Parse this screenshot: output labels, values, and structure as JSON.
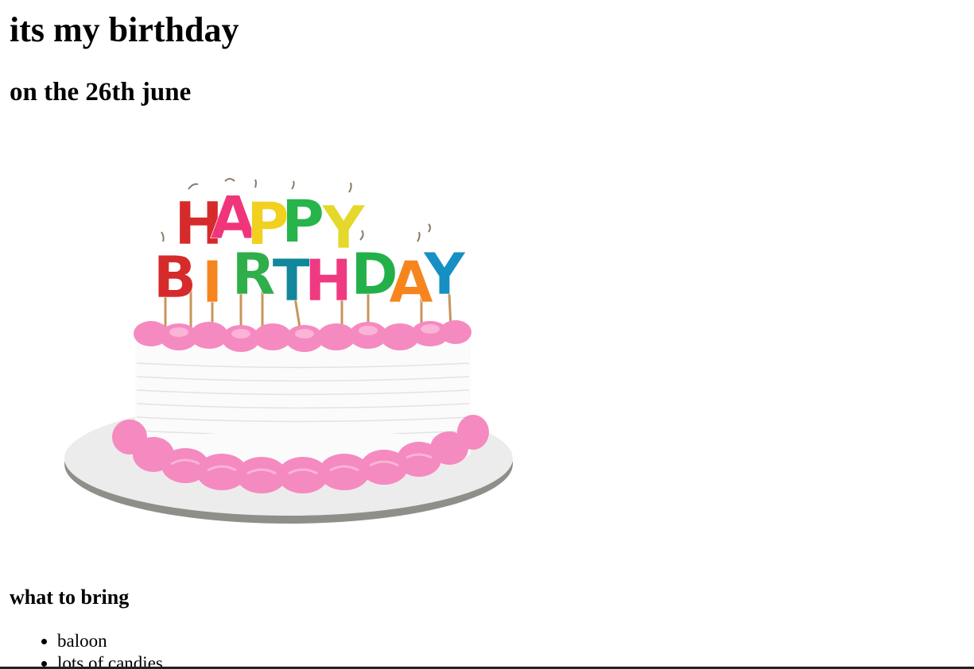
{
  "page": {
    "title": "its my birthday",
    "subtitle": "on the 26th june"
  },
  "cake_image": {
    "icon": "birthday-cake-image",
    "candle_letters_top": [
      "H",
      "A",
      "P",
      "P",
      "Y"
    ],
    "candle_letters_bottom": [
      "B",
      "I",
      "R",
      "T",
      "H",
      "D",
      "A",
      "Y"
    ]
  },
  "bring_section": {
    "heading": "what to bring",
    "items": [
      "baloon",
      "lots of candies"
    ]
  },
  "colors": {
    "frosting": "#f58ac0",
    "cake": "#fafafa",
    "board": "#e6e6e6"
  }
}
